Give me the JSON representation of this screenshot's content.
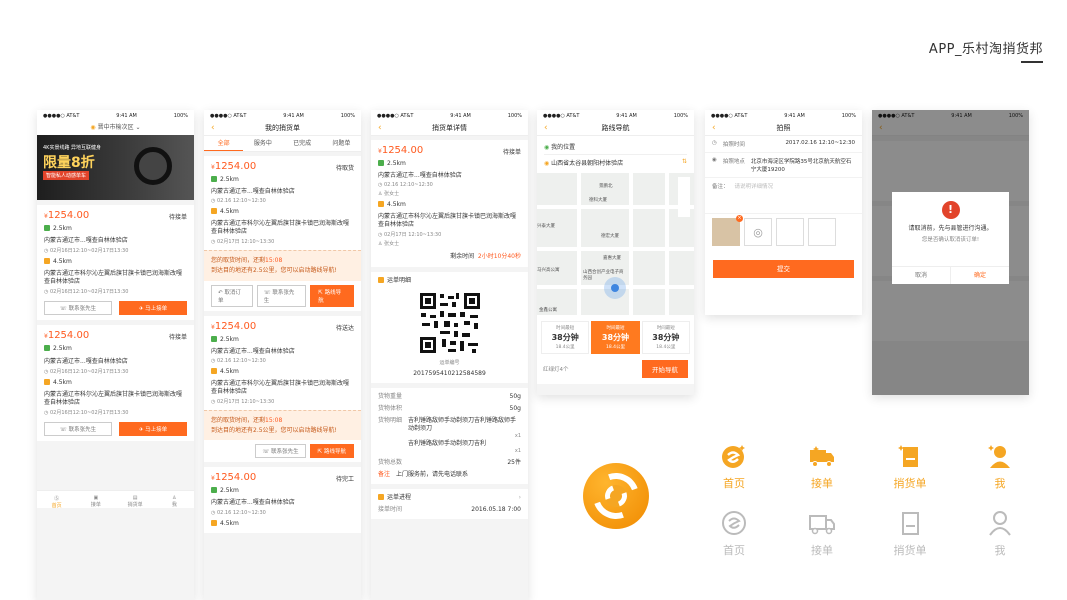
{
  "header": {
    "title": "APP_乐村淘捎货邦"
  },
  "status": {
    "carrier": "●●●●○ AT&T",
    "time": "9:41 AM",
    "battery": "100%"
  },
  "p1": {
    "location": "晋中市榆次区",
    "banner": {
      "line1": "4K实景线路  异地互联健身",
      "line2": "限量8折",
      "line3": "智能私人动感单车"
    },
    "orders": [
      {
        "price": "1254.00",
        "status": "待接单",
        "dist1": "2.5km",
        "addr1": "内蒙古通辽市...嘎查自林体验店",
        "time1": "02月16日12:10~02月17日13:30",
        "dist2": "4.5km",
        "addr2": "内蒙古通辽市科尔沁左翼后旗甘旗卡镇巴润海斯改嘎查自林体验店",
        "time2": "02月16日12:10~02月17日13:30",
        "btn_contact": "联系张先生",
        "btn_accept": "马上接单"
      },
      {
        "price": "1254.00",
        "status": "待接单",
        "dist1": "2.5km",
        "addr1": "内蒙古通辽市...嘎查自林体验店",
        "time1": "02月16日12:10~02月17日13:30",
        "dist2": "4.5km",
        "addr2": "内蒙古通辽市科尔沁左翼后旗甘旗卡镇巴润海斯改嘎查自林体验店",
        "time2": "02月16日12:10~02月17日13:30",
        "btn_contact": "联系张先生",
        "btn_accept": "马上接单"
      }
    ],
    "tabs": [
      "首页",
      "接单",
      "捎货单",
      "我"
    ]
  },
  "p2": {
    "title": "我的捎货单",
    "segs": [
      "全部",
      "服务中",
      "已完成",
      "问题单"
    ],
    "orders": [
      {
        "price": "1254.00",
        "status": "待取货",
        "dist1": "2.5km",
        "addr1": "内蒙古通辽市...嘎查自林体验店",
        "time1": "02.16  12:10~12:30",
        "dist2": "4.5km",
        "addr2": "内蒙古通辽市科尔沁左翼后旗甘旗卡镇巴润海斯改嘎查自林体验店",
        "time2": "02月17日   12:10~13:30",
        "notice1": "您的取货时间，还剩",
        "notice_time": "15:08",
        "notice2": "到达目的地还有2.5公里，您可以启动路线导航!",
        "btn_cancel": "取消订单",
        "btn_contact": "联系张先生",
        "btn_nav": "路线导航"
      },
      {
        "price": "1254.00",
        "status": "待送达",
        "dist1": "2.5km",
        "addr1": "内蒙古通辽市...嘎查自林体验店",
        "time1": "02.16  12:10~12:30",
        "dist2": "4.5km",
        "addr2": "内蒙古通辽市科尔沁左翼后旗甘旗卡镇巴润海斯改嘎查自林体验店",
        "time2": "02月17日   12:10~13:30",
        "notice1": "您的取货时间，还剩",
        "notice_time": "15:08",
        "notice2": "到达目的地还有2.5公里，您可以启动路线导航!",
        "btn_contact": "联系张先生",
        "btn_nav": "路线导航"
      },
      {
        "price": "1254.00",
        "status": "待完工",
        "dist1": "2.5km",
        "addr1": "内蒙古通辽市...嘎查自林体验店",
        "time1": "02.16  12:10~12:30",
        "dist2": "4.5km"
      }
    ]
  },
  "p3": {
    "title": "捎货单详情",
    "price": "1254.00",
    "status": "待接单",
    "dist1": "2.5km",
    "addr1": "内蒙古通辽市...嘎查自林体验店",
    "time1": "02.16  12:10~12:30",
    "person1": "张女士",
    "dist2": "4.5km",
    "addr2": "内蒙古通辽市科尔沁左翼后旗甘旗卡镇巴润海斯改嘎查自林体验店",
    "time2": "02月17日   12:10~13:30",
    "person2": "张女士",
    "remain_label": "剩余时间",
    "remain_value": "2小时10分40秒",
    "detail_title": "运单明细",
    "qr_caption": "运单编号",
    "order_no": "2017595410212584589",
    "weight_label": "货物重量",
    "weight": "50g",
    "volume_label": "货物体积",
    "volume": "50g",
    "goods_label": "货物明细",
    "goods": [
      {
        "name": "吉利锤路敌师手动剃须刀吉利锤路敌师手动剃须刀",
        "qty": "x1"
      },
      {
        "name": "吉利锤路敌师手动剃须刀吉利",
        "qty": "x1"
      }
    ],
    "total_label": "货物总数",
    "total": "25件",
    "remark_label": "备注",
    "remark": "上门服务前，请先电话联系",
    "progress_title": "运单进程",
    "progress_label": "接单时间",
    "progress_time": "2016.05.18   7:00"
  },
  "p4": {
    "title": "路线导航",
    "from": "我的位置",
    "to": "山西省太谷县朝阳村体验店",
    "map_labels": [
      "景鹏北",
      "德科大厦",
      "兴泰大厦",
      "德宏大厦",
      "嘉惠大厦",
      "山西合创产业电子商务园",
      "马兴高公寓",
      "金鑫公寓"
    ],
    "routes": [
      {
        "label": "时间最短",
        "time": "38分钟",
        "dist": "18.4公里"
      },
      {
        "label": "时间最短",
        "time": "38分钟",
        "dist": "18.4公里"
      },
      {
        "label": "时间最短",
        "time": "38分钟",
        "dist": "18.4公里"
      }
    ],
    "lights": "红绿灯4个",
    "start": "开始导航"
  },
  "p5": {
    "title": "拍照",
    "time_label": "拍照时间",
    "time_value": "2017.02.16  12:10~12:30",
    "place_label": "拍照地点",
    "place_value": "北京市海淀区学院路35号北京航天航空石宁大厦19200",
    "note_label": "备注：",
    "note_placeholder": "请说明详细情况",
    "submit": "提交"
  },
  "p6": {
    "dialog_msg1": "请取消前，先与县管进行沟通。",
    "dialog_msg2": "您是否确认取消该订单!",
    "cancel": "取消",
    "confirm": "确定"
  },
  "tab_icons": {
    "labels": [
      "首页",
      "接单",
      "捎货单",
      "我"
    ],
    "active_color": "#f5a623",
    "inactive_color": "#bbbbbb"
  },
  "colors": {
    "accent": "#ff6a1f",
    "brand": "#f5a623"
  }
}
